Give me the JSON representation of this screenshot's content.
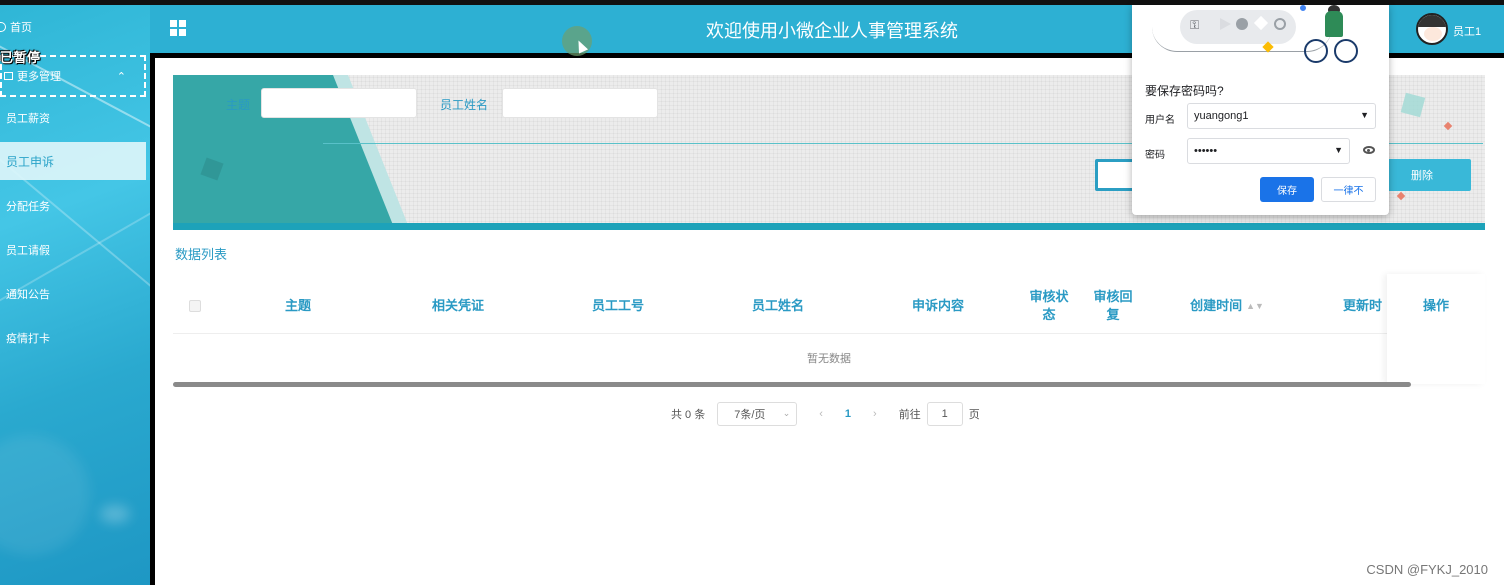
{
  "header": {
    "title": "欢迎使用小微企业人事管理系统",
    "user_name": "员工1"
  },
  "sidebar": {
    "home": "首页",
    "paused_overlay": "已暂停",
    "group": "更多管理",
    "items": [
      {
        "label": "员工薪资",
        "active": false
      },
      {
        "label": "员工申诉",
        "active": true
      },
      {
        "label": "分配任务",
        "active": false
      },
      {
        "label": "员工请假",
        "active": false
      },
      {
        "label": "通知公告",
        "active": false
      },
      {
        "label": "疫情打卡",
        "active": false
      }
    ]
  },
  "search": {
    "subject_label": "主题",
    "employee_name_label": "员工姓名",
    "delete_label": "删除"
  },
  "list": {
    "title": "数据列表",
    "columns": [
      "主题",
      "相关凭证",
      "员工工号",
      "员工姓名",
      "申诉内容",
      "审核状态",
      "审核回复",
      "创建时间",
      "更新时",
      "操作"
    ],
    "empty_text": "暂无数据"
  },
  "pagination": {
    "total": "共 0 条",
    "page_size": "7条/页",
    "current_page": "1",
    "goto_label": "前往",
    "goto_value": "1",
    "page_suffix": "页"
  },
  "password_popup": {
    "title": "要保存密码吗?",
    "username_label": "用户名",
    "username_value": "yuangong1",
    "password_label": "密码",
    "password_value": "••••••",
    "save_label": "保存",
    "never_label": "一律不"
  },
  "watermark": "CSDN @FYKJ_2010",
  "colors": {
    "accent": "#2db0d3",
    "link": "#2a9ac4",
    "chrome_blue": "#1a73e8"
  }
}
